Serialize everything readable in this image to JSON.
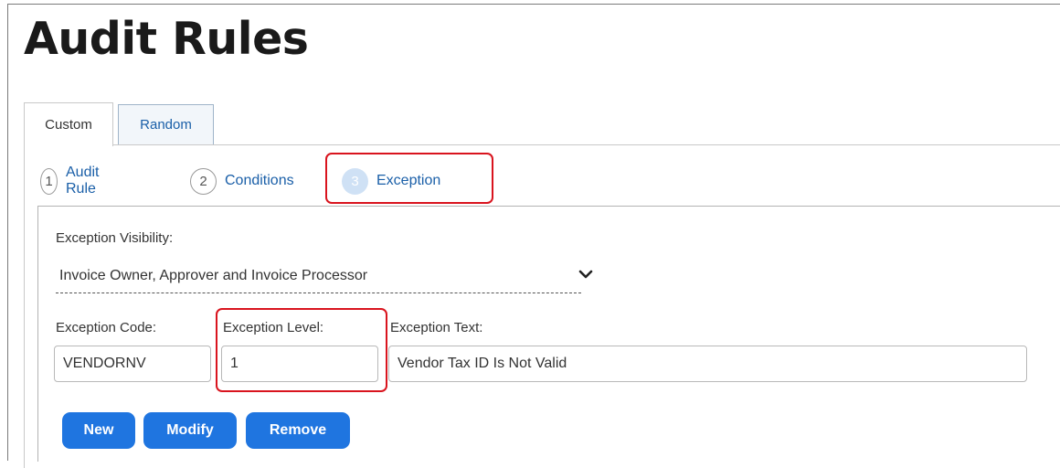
{
  "page_title": "Audit Rules",
  "tabs": [
    {
      "label": "Custom",
      "active": true
    },
    {
      "label": "Random",
      "active": false
    }
  ],
  "steps": [
    {
      "number": "1",
      "label": "Audit Rule",
      "current": false
    },
    {
      "number": "2",
      "label": "Conditions",
      "current": false
    },
    {
      "number": "3",
      "label": "Exception",
      "current": true
    }
  ],
  "form": {
    "visibility_label": "Exception Visibility:",
    "visibility_value": "Invoice Owner, Approver and Invoice Processor",
    "code_label": "Exception Code:",
    "code_value": "VENDORNV",
    "level_label": "Exception Level:",
    "level_value": "1",
    "text_label": "Exception Text:",
    "text_value": "Vendor Tax ID Is Not Valid"
  },
  "buttons": {
    "new": "New",
    "modify": "Modify",
    "remove": "Remove"
  },
  "colors": {
    "accent": "#1f75e0",
    "link": "#1a5fa8",
    "highlight": "#d9141e"
  },
  "icons": {
    "dropdown": "chevron-down-icon"
  }
}
